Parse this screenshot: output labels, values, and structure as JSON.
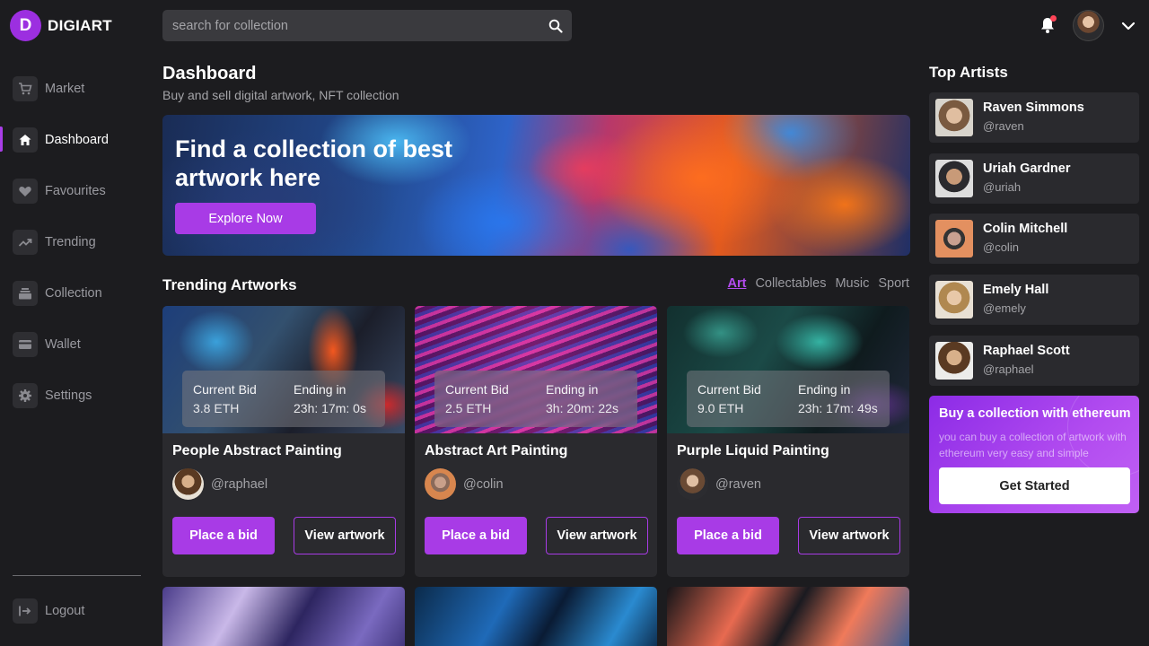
{
  "brand": {
    "logo_letter": "D",
    "name": "DIGIART",
    "accent": "#a83be6"
  },
  "search": {
    "placeholder": "search for collection",
    "value": ""
  },
  "header": {
    "notification_icon": "bell-icon",
    "has_unread": true,
    "profile_menu_icon": "chevron-down-icon"
  },
  "sidebar": {
    "items": [
      {
        "label": "Market",
        "icon": "cart-icon",
        "active": false
      },
      {
        "label": "Dashboard",
        "icon": "home-icon",
        "active": true
      },
      {
        "label": "Favourites",
        "icon": "heart-icon",
        "active": false
      },
      {
        "label": "Trending",
        "icon": "trending-icon",
        "active": false
      },
      {
        "label": "Collection",
        "icon": "collection-icon",
        "active": false
      },
      {
        "label": "Wallet",
        "icon": "wallet-icon",
        "active": false
      },
      {
        "label": "Settings",
        "icon": "gear-icon",
        "active": false
      }
    ],
    "logout_label": "Logout"
  },
  "main": {
    "title": "Dashboard",
    "subtitle": "Buy and sell digital artwork, NFT collection",
    "banner": {
      "title": "Find a collection of best artwork here",
      "button": "Explore Now"
    },
    "trending": {
      "title": "Trending Artworks",
      "filters": [
        {
          "label": "Art",
          "active": true
        },
        {
          "label": "Collectables",
          "active": false
        },
        {
          "label": "Music",
          "active": false
        },
        {
          "label": "Sport",
          "active": false
        }
      ],
      "bid_label": "Current Bid",
      "ending_label": "Ending in",
      "place_bid_label": "Place a bid",
      "view_label": "View artwork",
      "cards": [
        {
          "title": "People Abstract Painting",
          "bid": "3.8 ETH",
          "ending": "23h: 17m: 0s",
          "owner": "@raphael"
        },
        {
          "title": "Abstract Art Painting",
          "bid": "2.5 ETH",
          "ending": "3h: 20m: 22s",
          "owner": "@colin"
        },
        {
          "title": "Purple Liquid Painting",
          "bid": "9.0 ETH",
          "ending": "23h: 17m: 49s",
          "owner": "@raven"
        }
      ]
    }
  },
  "top_artists": {
    "title": "Top Artists",
    "artists": [
      {
        "name": "Raven Simmons",
        "handle": "@raven"
      },
      {
        "name": "Uriah Gardner",
        "handle": "@uriah"
      },
      {
        "name": "Colin Mitchell",
        "handle": "@colin"
      },
      {
        "name": "Emely Hall",
        "handle": "@emely"
      },
      {
        "name": "Raphael Scott",
        "handle": "@raphael"
      }
    ]
  },
  "promo": {
    "title": "Buy a collection with ethereum",
    "text": "you can buy a collection of artwork with ethereum very easy and simple",
    "button": "Get Started"
  }
}
